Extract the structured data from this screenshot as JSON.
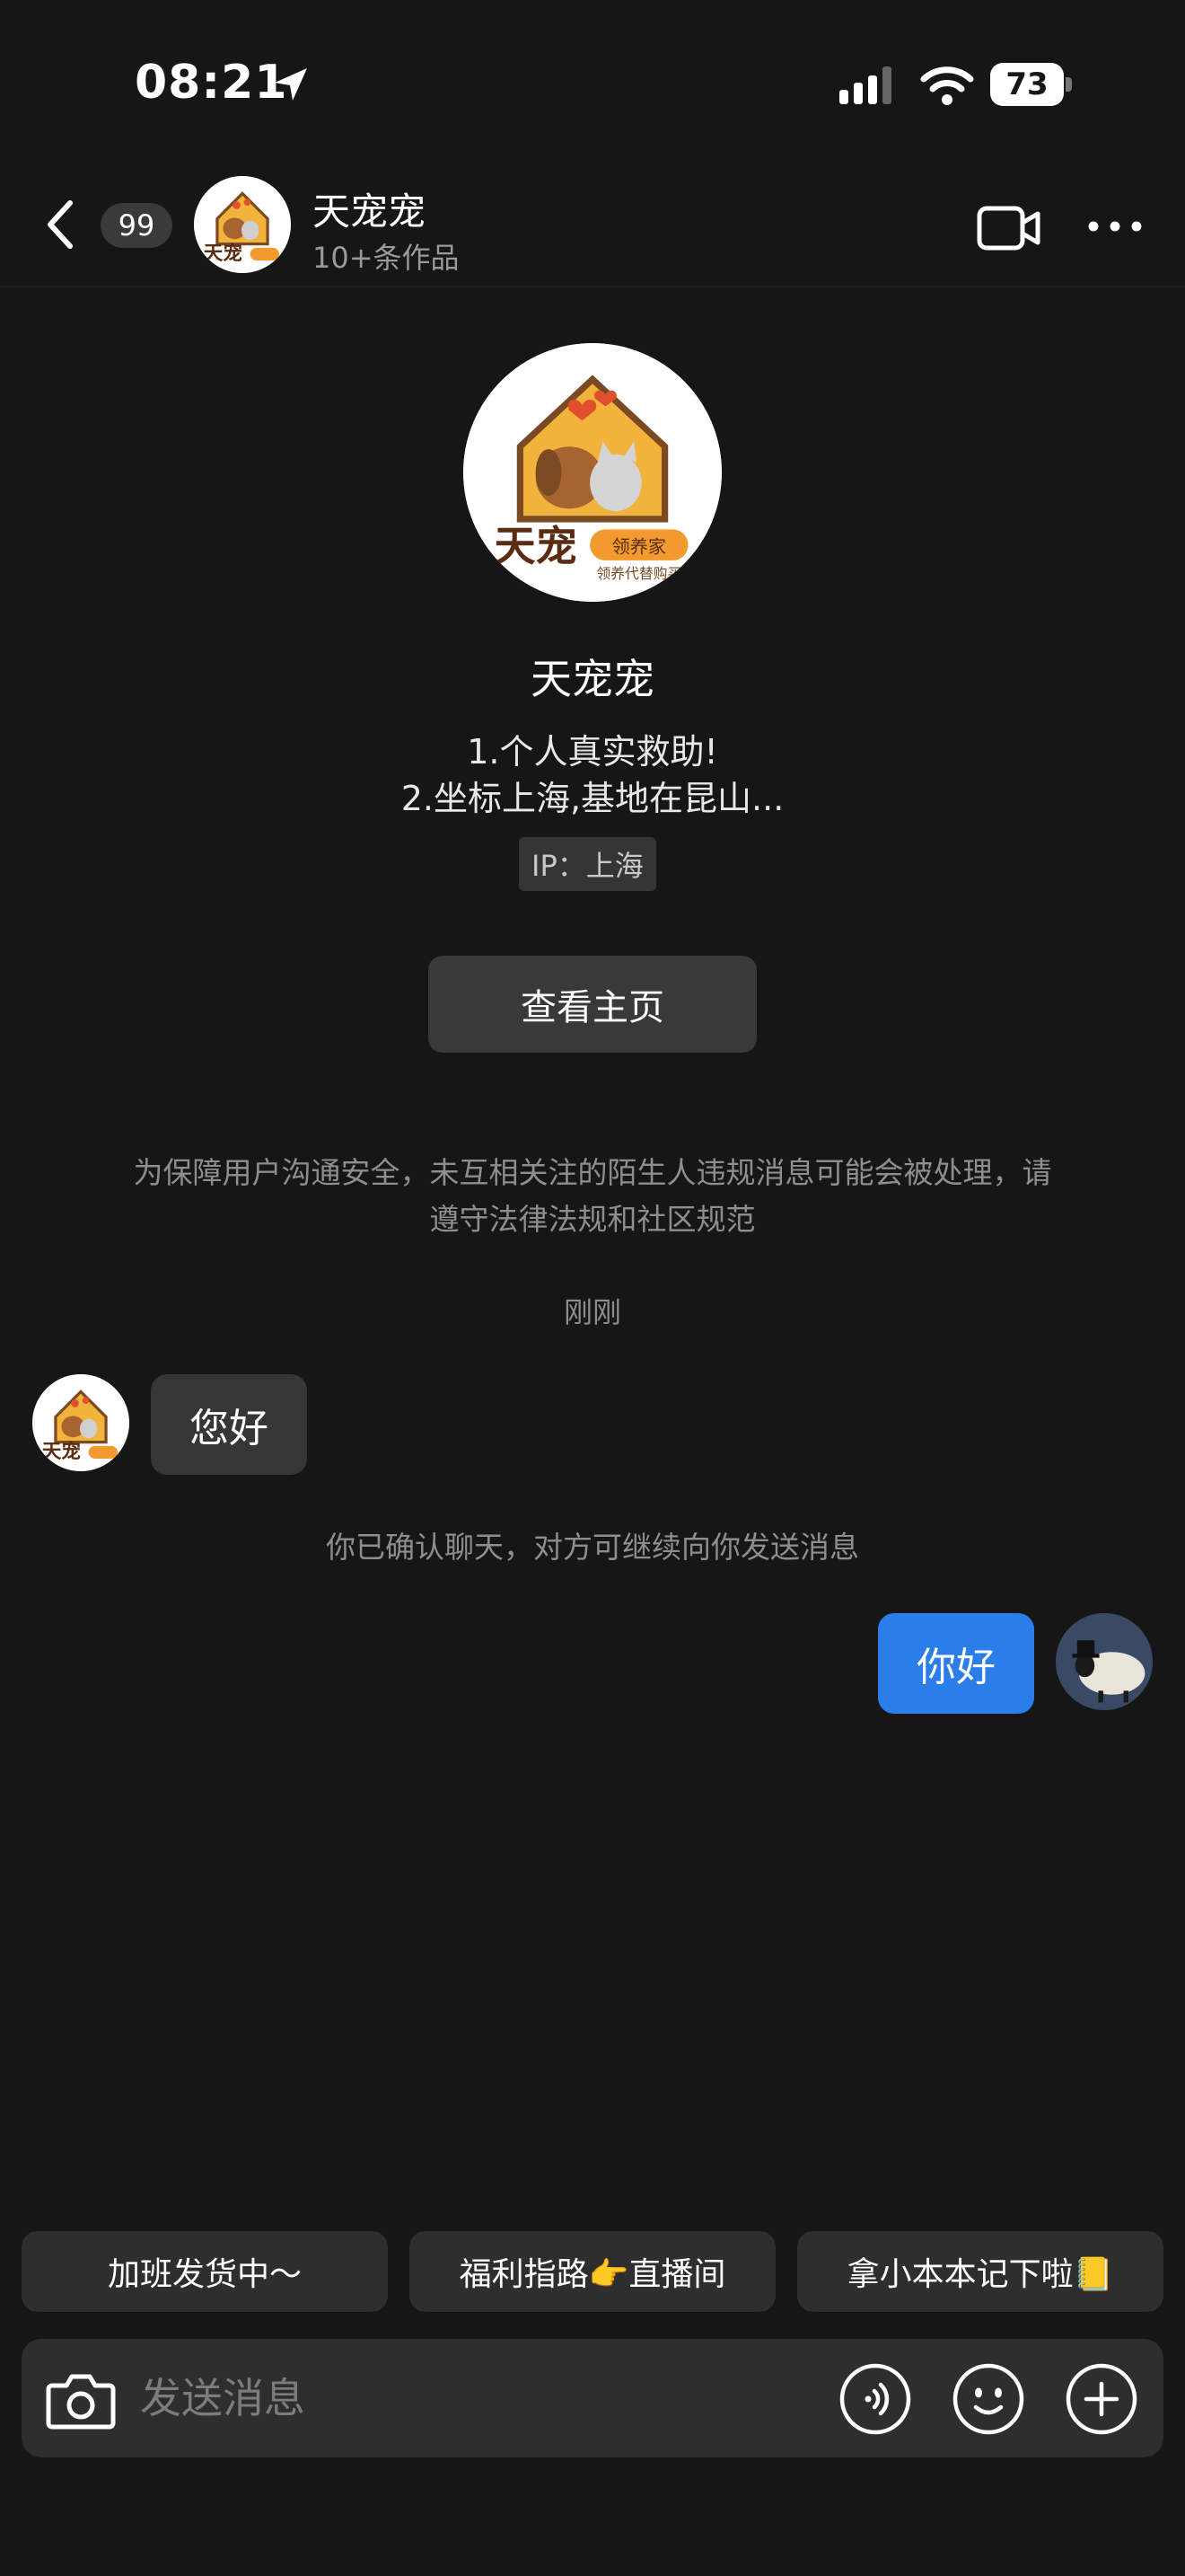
{
  "status_bar": {
    "time": "08:21",
    "battery": "73"
  },
  "header": {
    "unread_count": "99",
    "name": "天宠宠",
    "subtitle": "10+条作品",
    "avatar_brand": "天宠",
    "avatar_badge": "领养家",
    "avatar_caption": "领养代替购买"
  },
  "profile": {
    "name": "天宠宠",
    "bio_line1": "1.个人真实救助!",
    "bio_line2": "2.坐标上海,基地在昆山...",
    "ip": "IP：上海",
    "homepage_button": "查看主页"
  },
  "notice": "为保障用户沟通安全，未互相关注的陌生人违规消息可能会被处理，请遵守法律法规和社区规范",
  "timestamp": "刚刚",
  "messages": [
    {
      "side": "left",
      "text": "您好"
    },
    {
      "side": "right",
      "text": "你好"
    }
  ],
  "system_note": "你已确认聊天，对方可继续向你发送消息",
  "quick_replies": [
    "加班发货中～",
    "福利指路👉直播间",
    "拿小本本记下啦📒"
  ],
  "input": {
    "placeholder": "发送消息"
  },
  "colors": {
    "background": "#161616",
    "own_bubble": "#2b7de9",
    "other_bubble": "#363636"
  }
}
